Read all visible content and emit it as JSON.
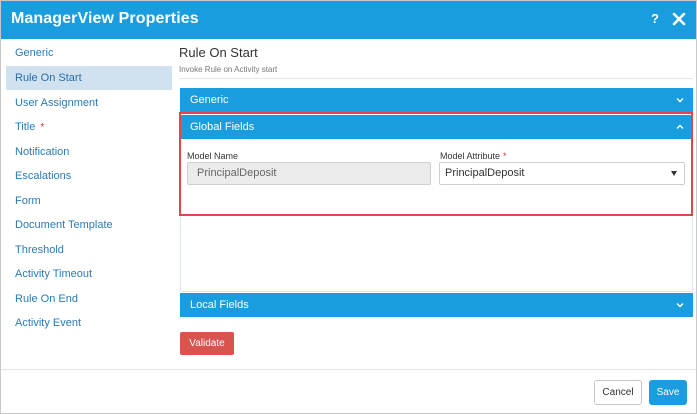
{
  "window": {
    "title": "ManagerView Properties",
    "help_label": "?",
    "close_label": "close"
  },
  "sidebar": {
    "items": [
      {
        "label": "Generic",
        "active": false,
        "required": false
      },
      {
        "label": "Rule On Start",
        "active": true,
        "required": false
      },
      {
        "label": "User Assignment",
        "active": false,
        "required": false
      },
      {
        "label": "Title",
        "active": false,
        "required": true
      },
      {
        "label": "Notification",
        "active": false,
        "required": false
      },
      {
        "label": "Escalations",
        "active": false,
        "required": false
      },
      {
        "label": "Form",
        "active": false,
        "required": false
      },
      {
        "label": "Document Template",
        "active": false,
        "required": false
      },
      {
        "label": "Threshold",
        "active": false,
        "required": false
      },
      {
        "label": "Activity Timeout",
        "active": false,
        "required": false
      },
      {
        "label": "Rule On End",
        "active": false,
        "required": false
      },
      {
        "label": "Activity Event",
        "active": false,
        "required": false
      }
    ],
    "required_mark": "*"
  },
  "main": {
    "title": "Rule On Start",
    "subtitle": "Invoke Rule on Activity start",
    "accordions": {
      "generic": {
        "label": "Generic",
        "expanded": false
      },
      "global_fields": {
        "label": "Global Fields",
        "expanded": true
      },
      "local_fields": {
        "label": "Local Fields",
        "expanded": false
      }
    },
    "global_fields": {
      "model_name_label": "Model Name",
      "model_name_value": "PrincipalDeposit",
      "model_attribute_label": "Model Attribute",
      "model_attribute_required": "*",
      "model_attribute_value": "PrincipalDeposit"
    },
    "validate_label": "Validate"
  },
  "footer": {
    "cancel_label": "Cancel",
    "save_label": "Save"
  },
  "colors": {
    "accent": "#1a9ddf",
    "danger": "#d9534f",
    "highlight_border": "#e0464a",
    "sidebar_active": "#d0e1ef",
    "link": "#2a7ab8"
  },
  "icons": {
    "help": "help-icon",
    "close": "close-icon",
    "chevron_down": "chevron-down-icon",
    "chevron_up": "chevron-up-icon",
    "caret": "dropdown-caret-icon"
  }
}
